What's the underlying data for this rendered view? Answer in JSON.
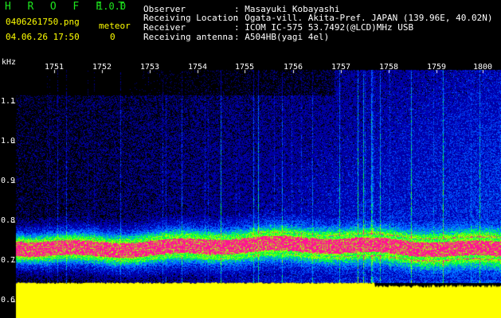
{
  "header": {
    "app_name": "H R O F F T",
    "version": "1.0.0",
    "filename": "0406261750.png",
    "datetime": "04.06.26 17:50",
    "meteor_label": "meteor",
    "meteor_count": "0",
    "info": [
      {
        "label": "Observer",
        "value": ": Masayuki Kobayashi"
      },
      {
        "label": "Receiving Location",
        "value": ": Ogata-vill. Akita-Pref. JAPAN (139.96E, 40.02N)"
      },
      {
        "label": "Receiver",
        "value": ": ICOM IC-575 53.7492(@LCD)MHz USB"
      },
      {
        "label": "Receiving antenna",
        "value": ": A504HB(yagi 4el)"
      }
    ]
  },
  "spectrogram": {
    "unit_label": "kHz",
    "freq_ticks": [
      "1.1",
      "1.0",
      "0.9",
      "0.8",
      "0.7",
      "0.6"
    ],
    "time_ticks": [
      "1751",
      "1752",
      "1753",
      "1754",
      "1755",
      "1756",
      "1757",
      "1758",
      "1759",
      "1800"
    ],
    "colors": {
      "background": "#000000",
      "noise_low": "#0000c8",
      "noise_mid": "#00a0ff",
      "signal_edge": "#00ff40",
      "signal_core": "#ff1493",
      "floor": "#ffff00"
    }
  }
}
